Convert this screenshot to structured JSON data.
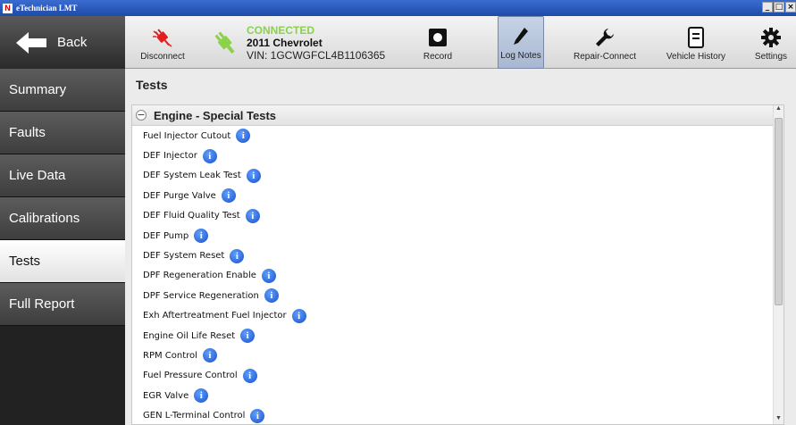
{
  "window": {
    "logo": "N",
    "title": "eTechnician LMT",
    "minimize": "_",
    "maximize": "□",
    "close": "×"
  },
  "toolbar": {
    "back_label": "Back",
    "disconnect_label": "Disconnect",
    "connection": {
      "status": "CONNECTED",
      "vehicle": "2011 Chevrolet",
      "vin": "VIN: 1GCWGFCL4B1106365"
    },
    "record_label": "Record",
    "log_notes_label": "Log Notes",
    "repair_connect_label": "Repair-Connect",
    "vehicle_history_label": "Vehicle History",
    "settings_label": "Settings"
  },
  "sidebar": {
    "items": [
      {
        "label": "Summary"
      },
      {
        "label": "Faults"
      },
      {
        "label": "Live Data"
      },
      {
        "label": "Calibrations"
      },
      {
        "label": "Tests"
      },
      {
        "label": "Full Report"
      }
    ]
  },
  "main": {
    "title": "Tests",
    "section": {
      "collapse_symbol": "−",
      "title": "Engine - Special Tests",
      "info_symbol": "i",
      "tests": [
        "Fuel Injector Cutout",
        "DEF Injector",
        "DEF System Leak Test",
        "DEF Purge Valve",
        "DEF Fluid Quality Test",
        "DEF Pump",
        "DEF System Reset",
        "DPF Regeneration Enable",
        "DPF Service Regeneration",
        "Exh Aftertreatment Fuel Injector",
        "Engine Oil Life Reset",
        "RPM Control",
        "Fuel Pressure Control",
        "EGR Valve",
        "GEN L-Terminal Control"
      ]
    }
  },
  "scrollbar": {
    "up": "▲",
    "down": "▼"
  },
  "colors": {
    "connected_green": "#8bd14a",
    "disconnect_red": "#e02020",
    "info_blue": "#1a4fc8",
    "titlebar_blue": "#2a5bbd"
  }
}
